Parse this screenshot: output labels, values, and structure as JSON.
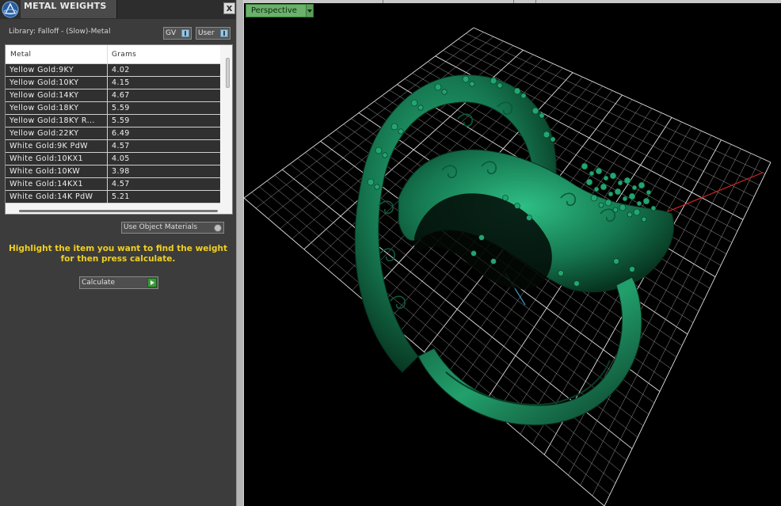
{
  "panel": {
    "title": "METAL WEIGHTS",
    "close_label": "x",
    "library_label": "Library: Falloff - (Slow)-Metal",
    "library_toggles": [
      {
        "label": "GV"
      },
      {
        "label": "User"
      }
    ],
    "table": {
      "columns": [
        "Metal",
        "Grams"
      ],
      "rows": [
        {
          "metal": "Yellow Gold:9KY",
          "grams": "4.02"
        },
        {
          "metal": "Yellow Gold:10KY",
          "grams": "4.15"
        },
        {
          "metal": "Yellow Gold:14KY",
          "grams": "4.67"
        },
        {
          "metal": "Yellow Gold:18KY",
          "grams": "5.59"
        },
        {
          "metal": "Yellow Gold:18KY R...",
          "grams": "5.59"
        },
        {
          "metal": "Yellow Gold:22KY",
          "grams": "6.49"
        },
        {
          "metal": "White Gold:9K PdW",
          "grams": "4.57"
        },
        {
          "metal": "White Gold:10KX1",
          "grams": "4.05"
        },
        {
          "metal": "White Gold:10KW",
          "grams": "3.98"
        },
        {
          "metal": "White Gold:14KX1",
          "grams": "4.57"
        },
        {
          "metal": "White Gold:14K PdW",
          "grams": "5.21"
        }
      ]
    },
    "use_object_materials_label": "Use Object Materials",
    "hint": "Highlight the item you want to find the weight for then press calculate.",
    "calculate_label": "Calculate"
  },
  "viewport": {
    "view_label": "Perspective"
  },
  "colors": {
    "accent_yellow": "#f0d020",
    "ring_green": "#1c8a5c",
    "grid": "#c8c8c8",
    "axis_red": "#e02020"
  }
}
